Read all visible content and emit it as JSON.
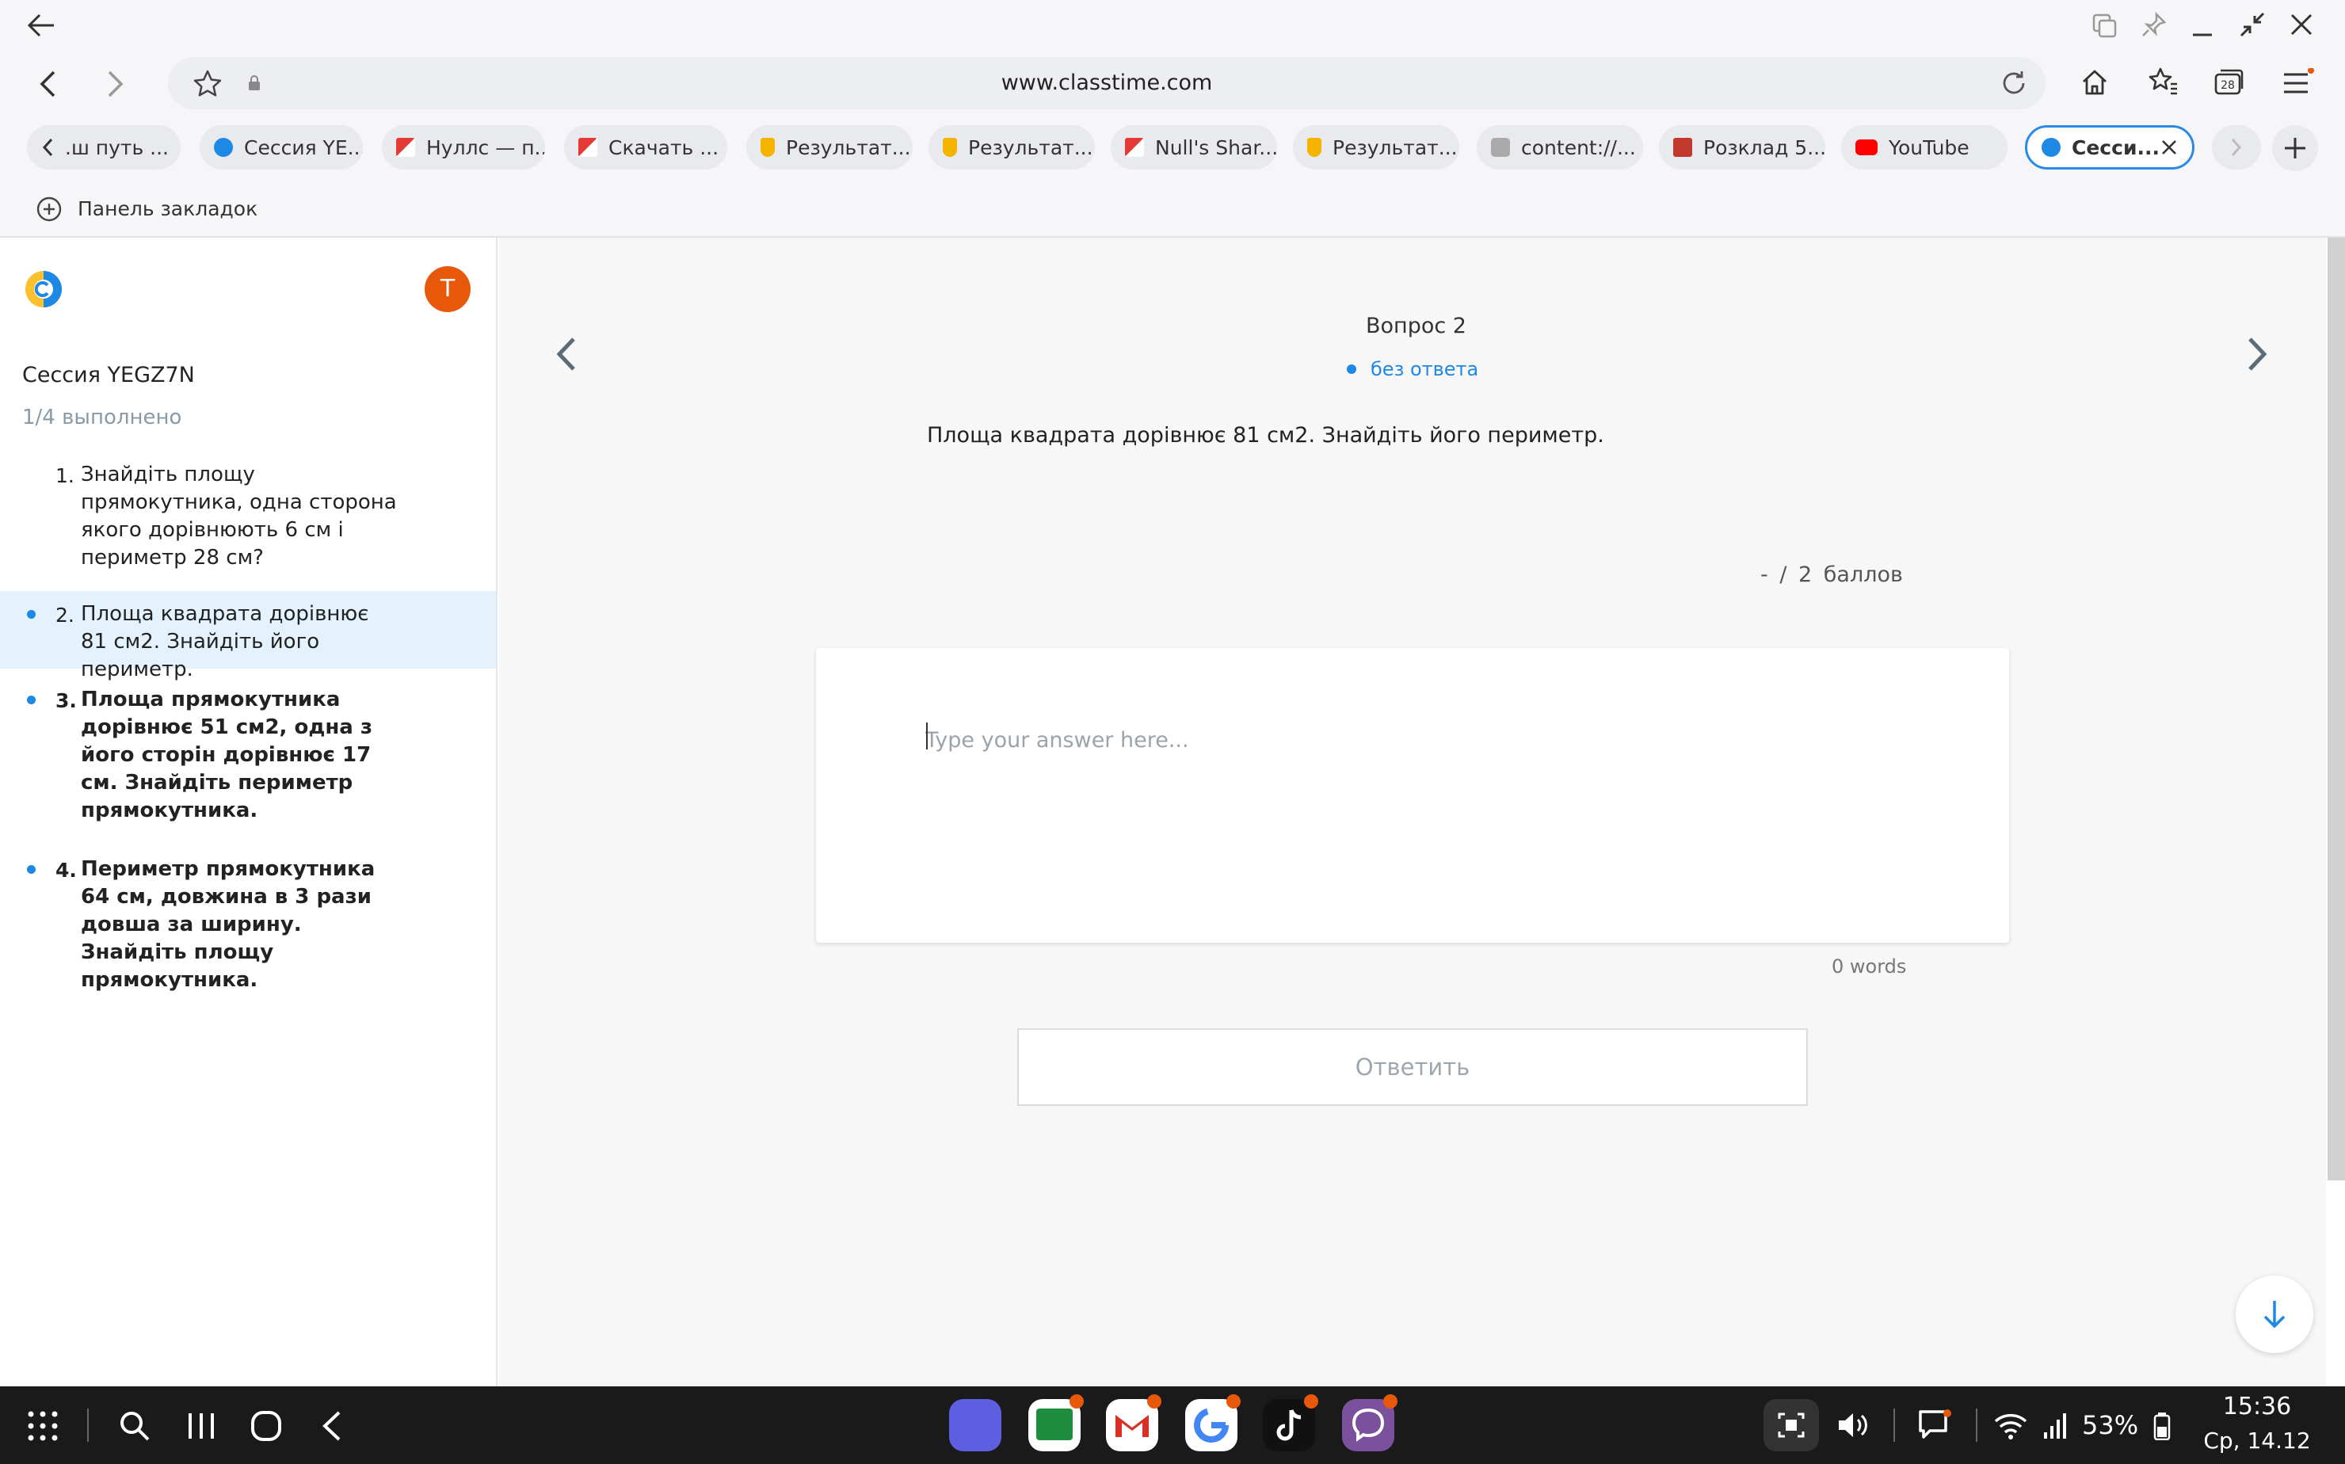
{
  "browser": {
    "url": "www.classtime.com",
    "tabs": [
      {
        "label": ".ш путь ...",
        "icon": "back-chevron-icon"
      },
      {
        "label": "Сессия YE...",
        "icon": "classtime-icon"
      },
      {
        "label": "Нуллс — п...",
        "icon": "nulls-icon"
      },
      {
        "label": "Скачать ...",
        "icon": "nulls-icon"
      },
      {
        "label": "Результат...",
        "icon": "bell-icon"
      },
      {
        "label": "Результат...",
        "icon": "bell-icon"
      },
      {
        "label": "Null's Shar...",
        "icon": "nulls-icon"
      },
      {
        "label": "Результат...",
        "icon": "bell-icon"
      },
      {
        "label": "content://...",
        "icon": "content-icon"
      },
      {
        "label": "Розклад 5...",
        "icon": "books-icon"
      },
      {
        "label": "YouTube",
        "icon": "youtube-icon"
      },
      {
        "label": "Сесси...",
        "icon": "classtime-icon"
      }
    ],
    "tab_count": "28",
    "bookmarks_label": "Панель закладок"
  },
  "sidebar": {
    "avatar_letter": "T",
    "session_title": "Сессия YEGZ7N",
    "progress": "1/4 выполнено",
    "questions": [
      {
        "num": "1.",
        "text": "Знайдіть площу прямокутника, одна сторона якого дорівнюють 6 см і периметр 28 см?"
      },
      {
        "num": "2.",
        "text": "Площа квадрата дорівнює 81 см2. Знайдіть його периметр."
      },
      {
        "num": "3.",
        "text": "Площа прямокутника дорівнює 51 см2, одна з його сторін дорівнює 17 см. Знайдіть периметр прямокутника."
      },
      {
        "num": "4.",
        "text": "Периметр прямокутника 64 см, довжина в 3 рази довша за ширину. Знайдіть площу прямокутника."
      }
    ]
  },
  "main": {
    "question_label": "Вопрос 2",
    "status": "без ответа",
    "question_text": "Площа квадрата дорівнює 81 см2. Знайдіть його периметр.",
    "score": "- / 2 баллов",
    "answer_placeholder": "Type your answer here...",
    "word_count": "0 words",
    "submit_label": "Ответить"
  },
  "system": {
    "battery": "53%",
    "time": "15:36",
    "date": "Ср, 14.12"
  },
  "colors": {
    "accent": "#1e88e5",
    "avatar": "#e8580a",
    "active_question_bg": "#e3f2fc"
  }
}
